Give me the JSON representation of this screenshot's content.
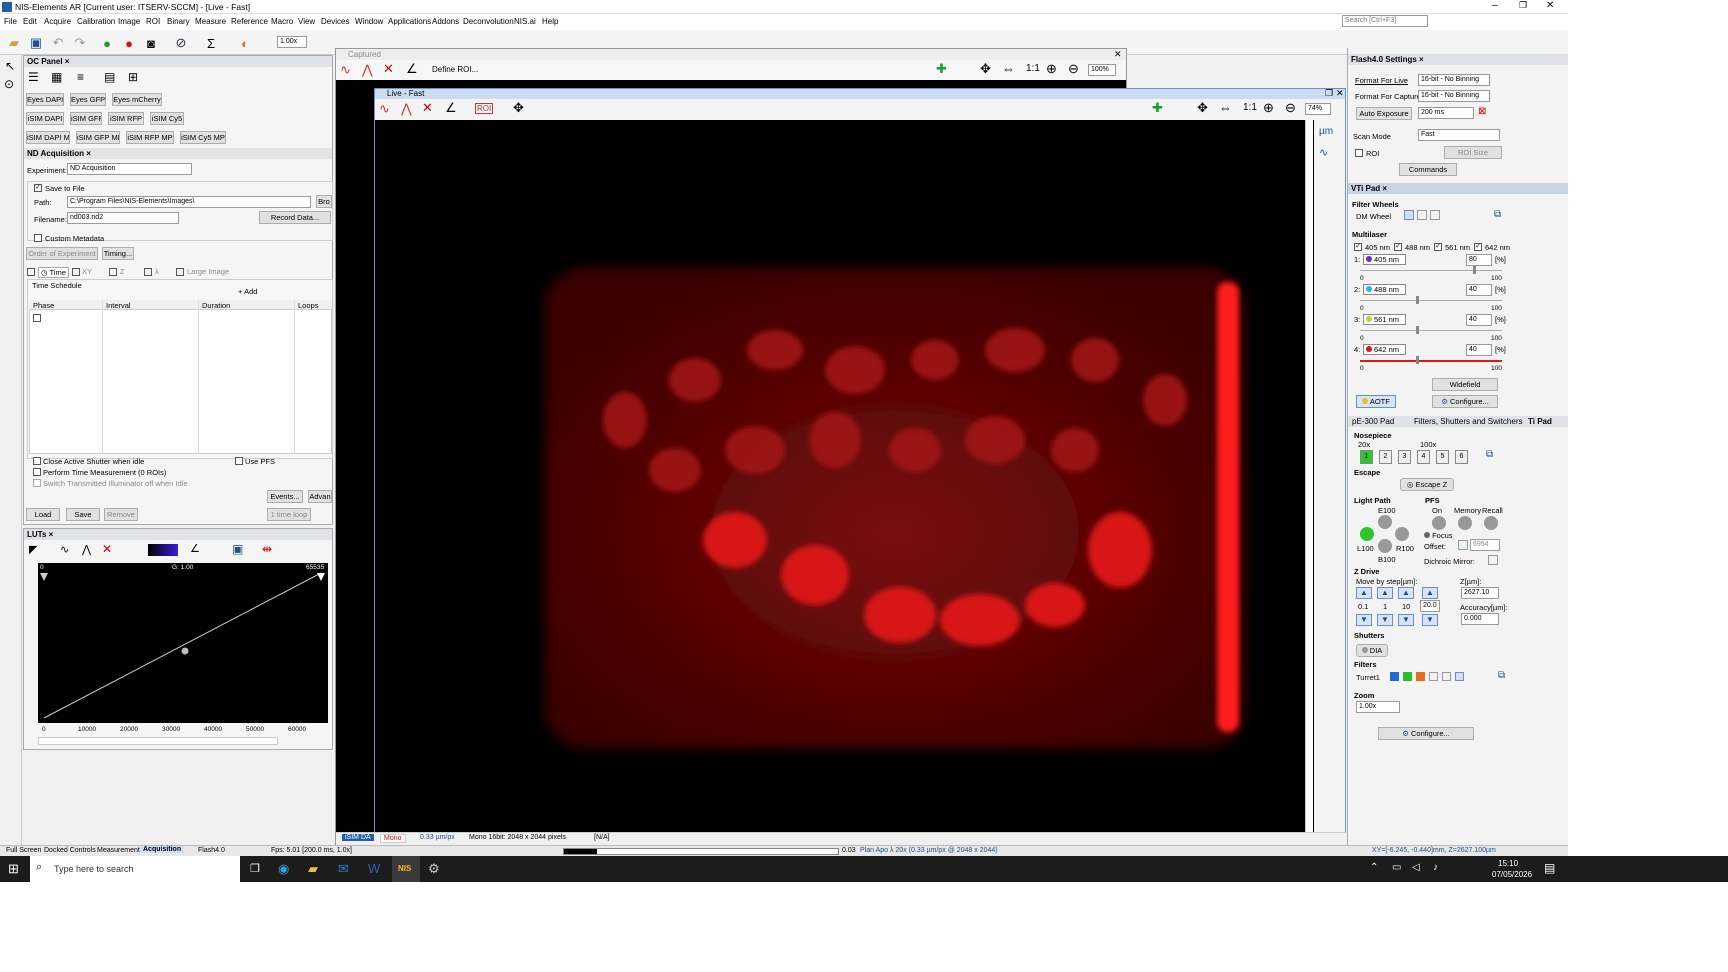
{
  "window": {
    "title": "NIS-Elements AR [Current user: ITSERV-SCCM] - [Live - Fast]"
  },
  "menu": [
    "File",
    "Edit",
    "Acquire",
    "Calibration",
    "Image",
    "ROI",
    "Binary",
    "Measure",
    "Reference",
    "Macro",
    "View",
    "Devices",
    "Window",
    "Applications",
    "Addons",
    "Deconvolution",
    "NIS.ai",
    "Help"
  ],
  "search": {
    "placeholder": "Search [Ctrl+F3]"
  },
  "toolbar": {
    "zoom": "1.00x"
  },
  "ocpanel": {
    "title": "OC Panel",
    "row1": [
      "Eyes DAPI",
      "Eyes GFP",
      "Eyes mCherry"
    ],
    "row2": [
      "iSIM DAPI",
      "iSIM GFP",
      "iSIM RFP",
      "iSIM Cy5"
    ],
    "row3": [
      "iSIM DAPI MP",
      "iSIM GFP MP",
      "iSIM RFP MP",
      "iSIM Cy5 MP"
    ]
  },
  "nd": {
    "tab": "ND Acquisition",
    "experiment_label": "Experiment:",
    "experiment": "ND Acquisition",
    "save_to_file": "Save to File",
    "path_label": "Path:",
    "path": "C:\\Program Files\\NIS-Elements\\Images\\",
    "browse": "Bro",
    "filename_label": "Filename:",
    "filename": "nd003.nd2",
    "record_data": "Record Data...",
    "custom_metadata": "Custom Metadata",
    "order": "Order of Experiment",
    "timing": "Timing...",
    "dims": [
      "Time",
      "XY",
      "Z",
      "λ",
      "Large Image"
    ],
    "time_schedule": "Time Schedule",
    "add": "Add",
    "columns": [
      "Phase",
      "Interval",
      "Duration",
      "Loops"
    ],
    "close_shutter": "Close Active Shutter when idle",
    "use_pfs": "Use PFS",
    "time_measure": "Perform Time Measurement (0 ROIs)",
    "switch_trans": "Switch Transmitted Illuminator off when Idle",
    "events": "Events...",
    "advanced": "Advan",
    "load": "Load",
    "save": "Save",
    "remove": "Remove",
    "run": "1 time loop"
  },
  "luts": {
    "title": "LUTs",
    "gamma": "G: 1.00",
    "min": "0",
    "max": "65535",
    "axis": [
      "0",
      "10000",
      "20000",
      "30000",
      "40000",
      "50000",
      "60000"
    ]
  },
  "captured": {
    "title": "Captured",
    "define_roi": "Define ROI...",
    "zoom": "100%"
  },
  "live": {
    "title": "Live - Fast",
    "zoom": "74%",
    "unit": "µm",
    "roi": "ROI"
  },
  "viewer_status": {
    "tab1": "iSIM DA",
    "tab2": "Mono",
    "calib": "0.33 µm/px",
    "info": "Mono 16bit: 2048 x 2044 pixels",
    "na": "[N/A]"
  },
  "flash": {
    "title": "Flash4.0 Settings",
    "format_live_label": "Format For Live",
    "format_live": "16-bit - No Binning",
    "format_capture_label": "Format For Capture",
    "format_capture": "16-bit - No Binning",
    "auto_exposure": "Auto Exposure",
    "exposure": "200 ms",
    "scan_mode_label": "Scan Mode",
    "scan_mode": "Fast",
    "roi": "ROI",
    "roi_size": "ROI Size",
    "commands": "Commands"
  },
  "ti": {
    "tab": "VTi Pad",
    "filter_wheels": "Filter Wheels",
    "dm_wheel": "DM Wheel",
    "multilaser": "Multilaser",
    "lasers": [
      {
        "idx": "1:",
        "name": "405 nm",
        "value": "80",
        "fill": 0.8,
        "color": "#6a2bd6"
      },
      {
        "idx": "2:",
        "name": "488 nm",
        "value": "40",
        "fill": 0.4,
        "color": "#29b6e0"
      },
      {
        "idx": "3:",
        "name": "561 nm",
        "value": "40",
        "fill": 0.4,
        "color": "#b5d43a"
      },
      {
        "idx": "4:",
        "name": "642 nm",
        "value": "40",
        "fill": 0.4,
        "color": "#e01515"
      }
    ],
    "laser_checks": [
      "405 nm",
      "488 nm",
      "561 nm",
      "642 nm"
    ],
    "pct": "[%]",
    "scale_min": "0",
    "scale_max": "100",
    "widefield": "Widefield",
    "aotf": "AOTF",
    "configure": "Configure..."
  },
  "tabs2": [
    "pE-300 Pad",
    "Filters, Shutters and Switchers",
    "Ti Pad"
  ],
  "tipad": {
    "nosepiece": "Nosepiece",
    "obj_20": "20x",
    "obj_100": "100x",
    "positions": [
      "1",
      "2",
      "3",
      "4",
      "5",
      "6"
    ],
    "escape": "Escape",
    "escape_z": "Escape Z",
    "light_path": "Light Path",
    "e100": "E100",
    "l100": "L100",
    "r100": "R100",
    "b100": "B100",
    "pfs": "PFS",
    "on": "On",
    "memory": "Memory",
    "recall": "Recall",
    "focus": "Focus",
    "offset_label": "Offset:",
    "offset": "6954",
    "dichroic": "Dichroic Mirror:",
    "zdrive": "Z Drive",
    "move_by": "Move by step[µm]:",
    "steps": [
      "0.1",
      "1",
      "10"
    ],
    "step_val": "20.0",
    "z_label": "Z[µm]:",
    "z": "2627.10",
    "accuracy_label": "Accuracy[µm]:",
    "accuracy": "0.000",
    "shutters": "Shutters",
    "dia": "DIA",
    "filters": "Filters",
    "turret": "Turret1",
    "zoom_label": "Zoom",
    "zoom": "1.00x",
    "configure": "Configure..."
  },
  "status": {
    "tabs": [
      "Full Screen",
      "Docked Controls",
      "Measurement",
      "Acquisition"
    ],
    "camera": "Flash4.0",
    "fps": "Fps: 5.01 [200.0 ms, 1.0x]",
    "val": "0.03",
    "objective": "Plan Apo λ 20x (0.33 µm/px @ 2048 x 2044)",
    "xyz": "XY=[-6.245, -0.440]mm, Z=2627.100µm"
  },
  "taskbar": {
    "search": "Type here to search",
    "time": "15:10",
    "date": "07/05/2026"
  }
}
